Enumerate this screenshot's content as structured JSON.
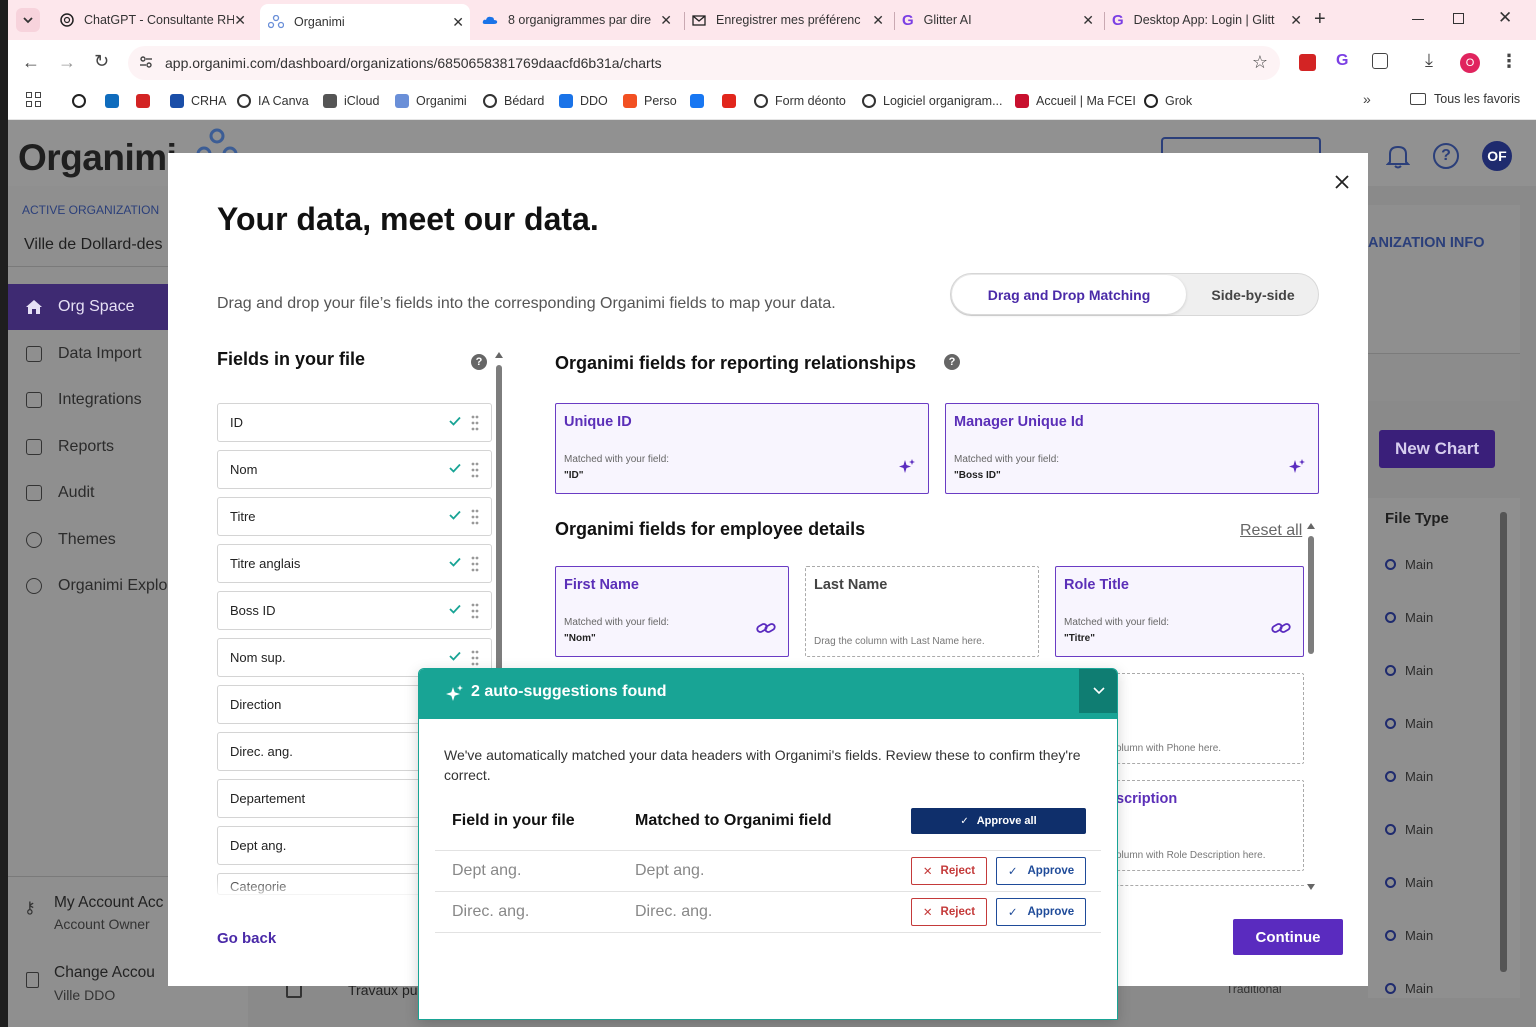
{
  "browser": {
    "tabs": [
      {
        "title": "ChatGPT - Consultante RH",
        "icon": "chatgpt-icon"
      },
      {
        "title": "Organimi",
        "icon": "organimi-icon"
      },
      {
        "title": "8 organigrammes par dire",
        "icon": "onedrive-icon"
      },
      {
        "title": "Enregistrer mes préférenc",
        "icon": "mail-icon"
      },
      {
        "title": "Glitter AI",
        "icon": "glitter-icon"
      },
      {
        "title": "Desktop App: Login | Glitt",
        "icon": "glitter-icon"
      }
    ],
    "url": "app.organimi.com/dashboard/organizations/6850658381769daacfd6b31a/charts",
    "profile_initial": "O",
    "bookmarks": [
      {
        "label": "",
        "icon": "chatgpt-icon"
      },
      {
        "label": "",
        "icon": "outlook-icon"
      },
      {
        "label": "",
        "icon": "pdf-icon"
      },
      {
        "label": "CRHA",
        "icon": "crha-icon"
      },
      {
        "label": "IA Canva",
        "icon": "globe-icon"
      },
      {
        "label": "iCloud",
        "icon": "apple-icon"
      },
      {
        "label": "Organimi",
        "icon": "organimi-icon"
      },
      {
        "label": "Bédard",
        "icon": "globe-icon"
      },
      {
        "label": "DDO",
        "icon": "onedrive-icon"
      },
      {
        "label": "Perso",
        "icon": "microsoft-icon"
      },
      {
        "label": "",
        "icon": "facebook-icon"
      },
      {
        "label": "",
        "icon": "adobe-icon"
      },
      {
        "label": "Form déonto",
        "icon": "globe-icon"
      },
      {
        "label": "Logiciel organigram...",
        "icon": "globe-icon"
      },
      {
        "label": "Accueil | Ma FCEI",
        "icon": "fcei-icon"
      },
      {
        "label": "Grok",
        "icon": "grok-icon"
      }
    ],
    "all_bookmarks_label": "Tous les favoris"
  },
  "app": {
    "logo": "Organimi",
    "active_org_label": "ACTIVE ORGANIZATION",
    "active_org_name": "Ville de Dollard-des",
    "nav": [
      {
        "label": "Org Space",
        "icon": "home-icon"
      },
      {
        "label": "Data Import",
        "icon": "file-import-icon"
      },
      {
        "label": "Integrations",
        "icon": "wrench-icon"
      },
      {
        "label": "Reports",
        "icon": "report-icon"
      },
      {
        "label": "Audit",
        "icon": "audit-icon"
      },
      {
        "label": "Themes",
        "icon": "palette-icon"
      },
      {
        "label": "Organimi Explo",
        "icon": "globe-icon"
      }
    ],
    "account": {
      "title": "My Account Acc",
      "subtitle": "Account Owner"
    },
    "change_account": {
      "title": "Change Accou",
      "subtitle": "Ville DDO"
    },
    "org_info_label": "ANIZATION INFO",
    "new_chart_label": "New Chart",
    "avatar_initials": "OF",
    "file_type_header": "File Type",
    "file_types": [
      "Main",
      "Main",
      "Main",
      "Main",
      "Main",
      "Main",
      "Main",
      "Main",
      "Main"
    ],
    "bottom_row": {
      "name": "Travaux pu",
      "type": "Traditional"
    }
  },
  "modal": {
    "title": "Your data, meet our data.",
    "subtitle": "Drag and drop your file’s fields into the corresponding Organimi fields to map your data.",
    "toggle": {
      "option1": "Drag and Drop Matching",
      "option2": "Side-by-side"
    },
    "left_heading": "Fields in your file",
    "file_fields": [
      {
        "name": "ID",
        "matched": true
      },
      {
        "name": "Nom",
        "matched": true
      },
      {
        "name": "Titre",
        "matched": true
      },
      {
        "name": "Titre anglais",
        "matched": true
      },
      {
        "name": "Boss ID",
        "matched": true
      },
      {
        "name": "Nom sup.",
        "matched": true
      },
      {
        "name": "Direction",
        "matched": false
      },
      {
        "name": "Direc. ang.",
        "matched": false
      },
      {
        "name": "Departement",
        "matched": false
      },
      {
        "name": "Dept ang.",
        "matched": false
      },
      {
        "name": "Categorie",
        "matched": false
      }
    ],
    "reporting_heading": "Organimi fields for reporting relationships",
    "matched_label": "Matched with your field:",
    "reporting_fields": [
      {
        "title": "Unique ID",
        "value": "\"ID\""
      },
      {
        "title": "Manager Unique Id",
        "value": "\"Boss ID\""
      }
    ],
    "employee_heading": "Organimi fields for employee details",
    "reset_all": "Reset all",
    "employee_fields": [
      {
        "title": "First Name",
        "value": "\"Nom\""
      },
      {
        "title": "Last Name",
        "drag_hint": "Drag the column with Last Name here."
      },
      {
        "title": "Role Title",
        "value": "\"Titre\""
      }
    ],
    "partial_hints": {
      "phone": "olumn with Phone here.",
      "role_desc_title": "scription",
      "role_desc_hint": "olumn with Role Description here."
    },
    "go_back": "Go back",
    "continue": "Continue"
  },
  "suggestions": {
    "title": "2 auto-suggestions found",
    "description": "We've automatically matched your data headers with Organimi's fields. Review these to confirm they're correct.",
    "col_file": "Field in your file",
    "col_organimi": "Matched to Organimi field",
    "approve_all": "Approve all",
    "reject_label": "Reject",
    "approve_label": "Approve",
    "rows": [
      {
        "file_field": "Dept ang.",
        "organimi_field": "Dept ang."
      },
      {
        "file_field": "Direc. ang.",
        "organimi_field": "Direc. ang."
      }
    ]
  }
}
